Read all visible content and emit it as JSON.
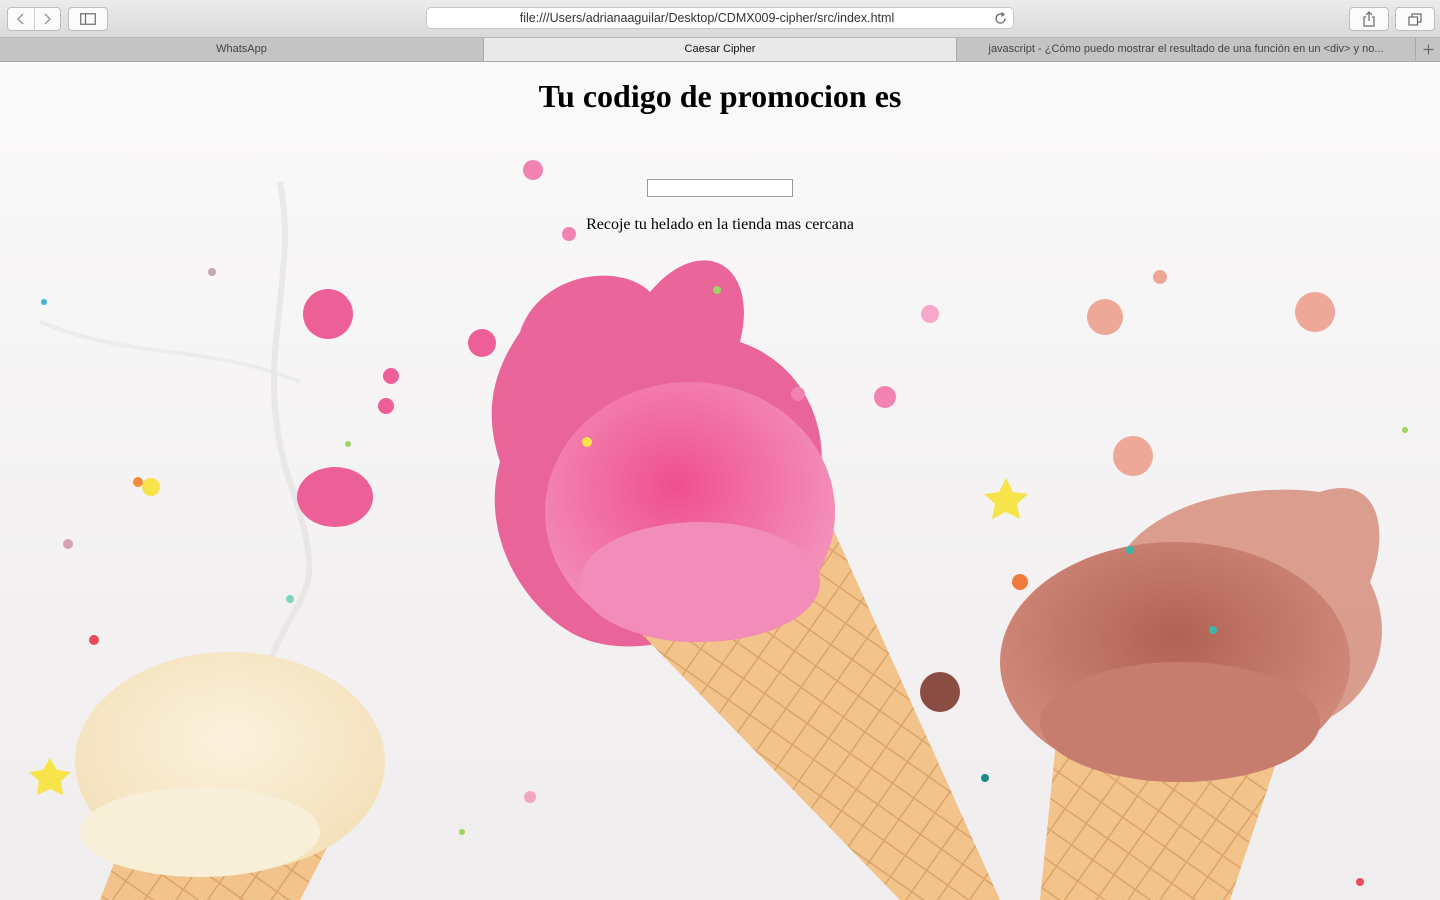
{
  "browser": {
    "url": "file:///Users/adrianaaguilar/Desktop/CDMX009-cipher/src/index.html",
    "tabs": [
      {
        "label": "WhatsApp",
        "active": false
      },
      {
        "label": "Caesar Cipher",
        "active": true
      },
      {
        "label": "javascript - ¿Cómo puedo mostrar el resultado de una función en un <div> y no...",
        "active": false
      }
    ],
    "icons": [
      "back-icon",
      "forward-icon",
      "sidebar-icon",
      "reload-icon",
      "share-icon",
      "tabs-overview-icon",
      "new-tab-icon"
    ]
  },
  "page": {
    "heading": "Tu codigo de promocion es",
    "code_value": "",
    "message": "Recoje tu helado en la tienda mas cercana",
    "background": "ice-cream-cones-photo",
    "colors": {
      "strawberry": "#e8558f",
      "chocolate": "#c2776a",
      "vanilla": "#f7ecd2",
      "cone": "#eebd82"
    }
  }
}
